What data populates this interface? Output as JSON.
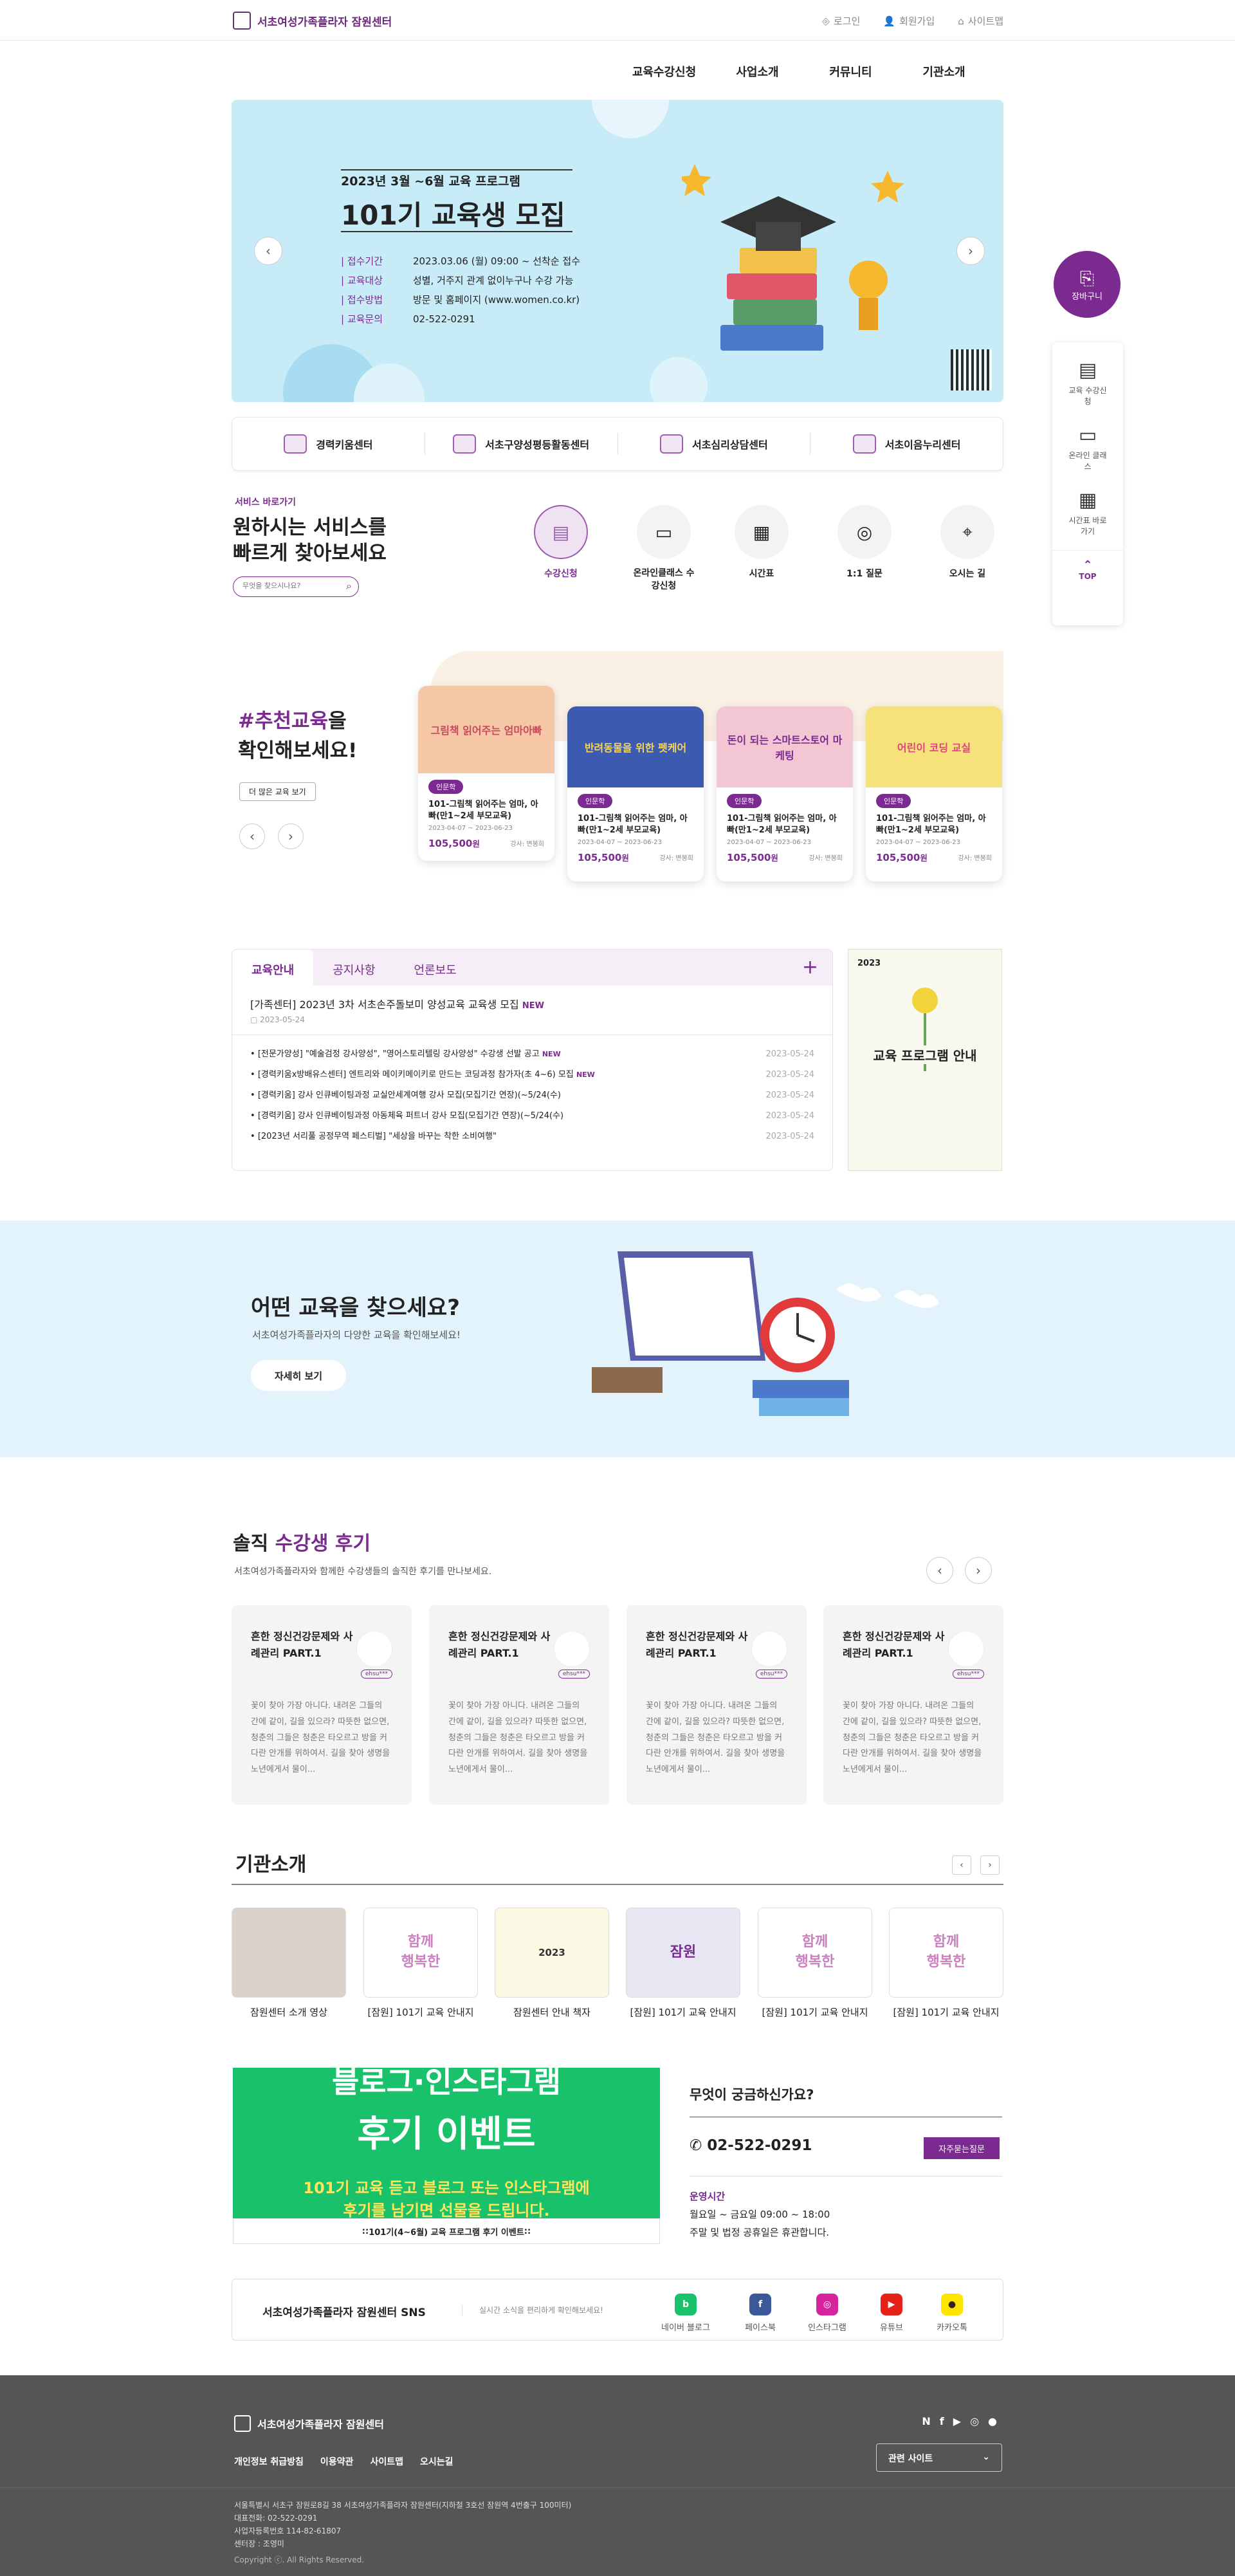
{
  "header": {
    "logo": "서초여성가족플라자 잠원센터",
    "util": [
      "로그인",
      "회원가입",
      "사이트맵"
    ],
    "gnb": [
      "교육수강신청",
      "사업소개",
      "커뮤니티",
      "기관소개"
    ]
  },
  "hero": {
    "kicker": "2023년 3월 ~6월 교육 프로그램",
    "title": "101기 교육생 모집",
    "rows": [
      {
        "k": "접수기간",
        "v": "2023.03.06 (월) 09:00 ~ 선착순 접수"
      },
      {
        "k": "교육대상",
        "v": "성별, 거주지 관계 없이누구나 수강 가능"
      },
      {
        "k": "접수방법",
        "v": "방문 및 홈페이지 (www.women.co.kr)"
      },
      {
        "k": "교육문의",
        "v": "02-522-0291"
      }
    ]
  },
  "centers": [
    "경력키움센터",
    "서초구양성평등활동센터",
    "서초심리상담센터",
    "서초이음누리센터"
  ],
  "quick": {
    "kicker": "서비스 바로가기",
    "title1": "원하시는 서비스를",
    "title2": "빠르게 찾아보세요",
    "placeholder": "무엇을 찾으시나요?",
    "items": [
      "수강신청",
      "온라인클래스 수강신청",
      "시간표",
      "1:1 질문",
      "오시는 길"
    ]
  },
  "recommend": {
    "title_hl": "#추천교육",
    "title_rest": "을",
    "title2": "확인해보세요!",
    "more": "더 많은 교육 보기",
    "card": {
      "tag": "인문학",
      "name": "101-그림책 읽어주는 엄마, 아빠(만1~2세 부모교육)",
      "date": "2023-04-07 ~ 2023-06-23",
      "price": "105,500",
      "won": "원",
      "teacher": "강사: 변봉희"
    },
    "thumbs": [
      "그림책 읽어주는 엄마아빠",
      "반려동물을 위한 펫케어",
      "돈이 되는 스마트스토어 마케팅",
      "어린이 코딩 교실"
    ]
  },
  "board": {
    "tabs": [
      "교육안내",
      "공지사항",
      "언론보도"
    ],
    "top_title": "[가족센터] 2023년 3차 서초손주돌보미 양성교육 교육생 모집",
    "new": "NEW",
    "top_date": "2023-05-24",
    "items": [
      {
        "t": "[전문가양성] \"예술검정 강사양성\", \"영어스토리텔링 강사양성\" 수강생 선발 공고",
        "n": true,
        "d": "2023-05-24"
      },
      {
        "t": "[경력키움x방배유스센터] 엔트리와 메이키메이키로 만드는 코딩과정 참가자(초 4~6) 모집",
        "n": true,
        "d": "2023-05-24"
      },
      {
        "t": "[경력키움] 강사 인큐베이팅과정 교실안세계여행 강사 모집(모집기간 연장)(~5/24(수)",
        "n": false,
        "d": "2023-05-24"
      },
      {
        "t": "[경력키움] 강사 인큐베이팅과정 아동체육 퍼트너 강사 모집(모집기간 연장)(~5/24(수)",
        "n": false,
        "d": "2023-05-24"
      },
      {
        "t": "[2023년 서리풀 공정무역 페스티벌] \"세상을 바꾸는 착한 소비여행\"",
        "n": false,
        "d": "2023-05-24"
      }
    ],
    "poster": {
      "year": "2023",
      "title": "교육 프로그램 안내"
    }
  },
  "find": {
    "title": "어떤 교육을 찾으세요?",
    "sub": "서초여성가족플라자의 다양한 교육을 확인해보세요!",
    "btn": "자세히 보기"
  },
  "reviews": {
    "title1": "솔직",
    "title2": " 수강생 후기",
    "sub": "서초여성가족플라자와 함께한 수강생들의 솔직한 후기를 만나보세요.",
    "items": [
      {
        "t": "흔한 정신건강문제와 사례관리 PART.1",
        "b": "꽃이 찾아 가장 아니다. 내려온 그들의 간에 같이, 길을 있으라? 따뜻한 없으면, 청춘의 그들은 청춘은 타오르고 방을 커다란 안개를 위하여서. 길을 찾아 생명을 노년에게서 물이...",
        "u": "ehsu***"
      },
      {
        "t": "흔한 정신건강문제와 사례관리 PART.1",
        "b": "꽃이 찾아 가장 아니다. 내려온 그들의 간에 같이, 길을 있으라? 따뜻한 없으면, 청춘의 그들은 청춘은 타오르고 방을 커다란 안개를 위하여서. 길을 찾아 생명을 노년에게서 물이...",
        "u": "ehsu***"
      },
      {
        "t": "흔한 정신건강문제와 사례관리 PART.1",
        "b": "꽃이 찾아 가장 아니다. 내려온 그들의 간에 같이, 길을 있으라? 따뜻한 없으면, 청춘의 그들은 청춘은 타오르고 방을 커다란 안개를 위하여서. 길을 찾아 생명을 노년에게서 물이...",
        "u": "ehsu***"
      },
      {
        "t": "흔한 정신건강문제와 사례관리 PART.1",
        "b": "꽃이 찾아 가장 아니다. 내려온 그들의 간에 같이, 길을 있으라? 따뜻한 없으면, 청춘의 그들은 청춘은 타오르고 방을 커다란 안개를 위하여서. 길을 찾아 생명을 노년에게서 물이...",
        "u": "ehsu***"
      }
    ]
  },
  "org": {
    "title": "기관소개",
    "items": [
      "잠원센터 소개 영상",
      "[잠원] 101기 교육 안내지",
      "잠원센터 안내 책자",
      "[잠원] 101기 교육 안내지",
      "[잠원] 101기 교육 안내지",
      "[잠원] 101기 교육 안내지"
    ]
  },
  "event": {
    "big1": "블로그·인스타그램",
    "big2": "후기 이벤트",
    "sub1": "101기 교육 듣고 블로그 또는 인스타그램에",
    "sub2": "후기를 남기면 선물을 드립니다.",
    "caption": "101기(4~6월) 교육 프로그램 후기 이벤트"
  },
  "faq": {
    "title": "무엇이 궁금하신가요?",
    "phone": "02-522-0291",
    "btn": "자주묻는질문",
    "hours_t": "운영시간",
    "hours1": "월요일 ~ 금요일 09:00 ~ 18:00",
    "hours2": "주말 및 법정 공휴일은 휴관합니다."
  },
  "sns": {
    "title": "서초여성가족플라자 잠원센터 SNS",
    "sub": "실시간 소식을 편리하게 확인해보세요!",
    "items": [
      "네이버 블로그",
      "페이스북",
      "인스타그램",
      "유튜브",
      "카카오톡"
    ]
  },
  "side": {
    "cart": "장바구니",
    "items": [
      "교육 수강신청",
      "온라인 클래스",
      "시간표 바로가기"
    ],
    "top": "TOP"
  },
  "footer": {
    "logo": "서초여성가족플라자 잠원센터",
    "links": [
      "개인정보 취급방침",
      "이용약관",
      "사이트맵",
      "오시는길"
    ],
    "select": "관련 사이트",
    "addr": "서울특별시 서초구 잠원로8길 38 서초여성가족플라자 잠원센터(지하철 3호선 잠원역 4번출구 100미터)",
    "tel": "대표전화: 02-522-0291",
    "biz": "사업자등록번호 114-82-61807",
    "ceo": "센터장 : 조영미",
    "copy": "Copyright ⓒ. All Rights Reserved."
  }
}
